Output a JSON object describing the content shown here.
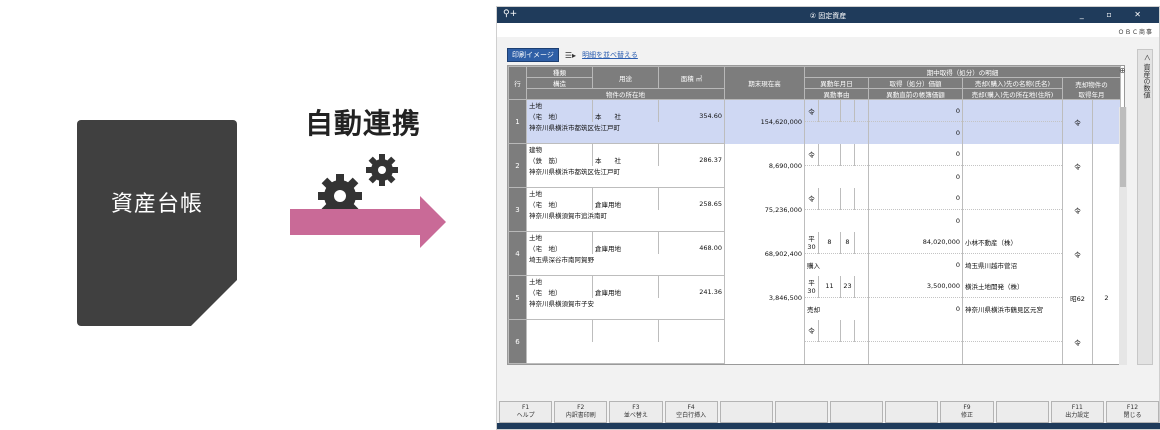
{
  "illustration": {
    "ledger_title": "資産台帳",
    "sync_label": "自動連携"
  },
  "window": {
    "title": "② 固定資産",
    "search_icon": "search-plus-icon",
    "controls": [
      "_",
      "□",
      "✕"
    ],
    "company": "ＯＢＣ商事"
  },
  "toolbar": {
    "print_image": "印刷イメージ",
    "reorder_link": "明細を並べ替える"
  },
  "side_tab": "＜ 資産の数値",
  "table": {
    "headers": {
      "row": "行",
      "kind": "種類",
      "structure": "構造",
      "use": "用途",
      "area": "面積",
      "area_unit": "㎡",
      "end_balance": "期末現在高",
      "location": "物件の所在地",
      "period_detail": "期中取得（処分）の明細",
      "date": "異動年月日",
      "reason": "異動事由",
      "acq_amount": "取得（処分）価額",
      "pre_book": "異動直前の帳簿価額",
      "partner_name": "売却(購入)先の名称(氏名)",
      "partner_addr": "売却(購入)先の所在地(住所)",
      "acq_ym1": "売却物件の",
      "acq_ym2": "取得年月"
    },
    "rows": [
      {
        "no": "1",
        "kind": "土地",
        "structure": "（宅　地）",
        "use": "本　　社",
        "area": "354.60",
        "location": "神奈川県横浜市都筑区佐江戸町",
        "balance": "154,620,000",
        "era": "令",
        "date_y": "",
        "date_m": "",
        "date_d": "",
        "reason": "",
        "acq": "0",
        "book": "0",
        "pname": "",
        "paddr": "",
        "ye": "令",
        "yn": ""
      },
      {
        "no": "2",
        "kind": "建物",
        "structure": "（鉄　筋）",
        "use": "本　　社",
        "area": "286.37",
        "location": "神奈川県横浜市都筑区佐江戸町",
        "balance": "8,690,000",
        "era": "令",
        "date_y": "",
        "date_m": "",
        "date_d": "",
        "reason": "",
        "acq": "0",
        "book": "0",
        "pname": "",
        "paddr": "",
        "ye": "令",
        "yn": ""
      },
      {
        "no": "3",
        "kind": "土地",
        "structure": "（宅　地）",
        "use": "倉庫用地",
        "area": "258.65",
        "location": "神奈川県横須賀市追浜南町",
        "balance": "75,236,000",
        "era": "令",
        "date_y": "",
        "date_m": "",
        "date_d": "",
        "reason": "",
        "acq": "0",
        "book": "0",
        "pname": "",
        "paddr": "",
        "ye": "令",
        "yn": ""
      },
      {
        "no": "4",
        "kind": "土地",
        "structure": "（宅　地）",
        "use": "倉庫用地",
        "area": "468.00",
        "location": "埼玉県深谷市南阿賀野",
        "balance": "68,902,400",
        "era": "平30",
        "date_y": "8",
        "date_m": "8",
        "date_d": "",
        "reason": "購入",
        "acq": "84,020,000",
        "book": "0",
        "pname": "小林不動産（株）",
        "paddr": "埼玉県川越市菅沼",
        "ye": "令",
        "yn": ""
      },
      {
        "no": "5",
        "kind": "土地",
        "structure": "（宅　地）",
        "use": "倉庫用地",
        "area": "241.36",
        "location": "神奈川県横須賀市子安",
        "balance": "3,846,500",
        "era": "平30",
        "date_y": "11",
        "date_m": "23",
        "date_d": "",
        "reason": "売却",
        "acq": "3,500,000",
        "book": "0",
        "pname": "横浜土地開発（株）",
        "paddr": "神奈川県横浜市鶴見区元宮",
        "ye": "昭62",
        "yn": "2"
      },
      {
        "no": "6",
        "kind": "",
        "structure": "",
        "use": "",
        "area": "",
        "location": "",
        "balance": "",
        "era": "令",
        "date_y": "",
        "date_m": "",
        "date_d": "",
        "reason": "",
        "acq": "",
        "book": "",
        "pname": "",
        "paddr": "",
        "ye": "令",
        "yn": ""
      }
    ]
  },
  "fkeys": [
    {
      "key": "F1",
      "label": "ヘルプ"
    },
    {
      "key": "F2",
      "label": "内訳書印刷"
    },
    {
      "key": "F3",
      "label": "並べ替え"
    },
    {
      "key": "F4",
      "label": "空白行挿入"
    },
    {
      "key": "",
      "label": ""
    },
    {
      "key": "",
      "label": ""
    },
    {
      "key": "",
      "label": ""
    },
    {
      "key": "",
      "label": ""
    },
    {
      "key": "F9",
      "label": "修正"
    },
    {
      "key": "",
      "label": ""
    },
    {
      "key": "F11",
      "label": "出力設定"
    },
    {
      "key": "F12",
      "label": "閉じる"
    }
  ],
  "colors": {
    "accent": "#c96a97",
    "titlebar": "#1f3b5b",
    "selected_row": "#cfd8f3",
    "header": "#7d7d7d"
  }
}
